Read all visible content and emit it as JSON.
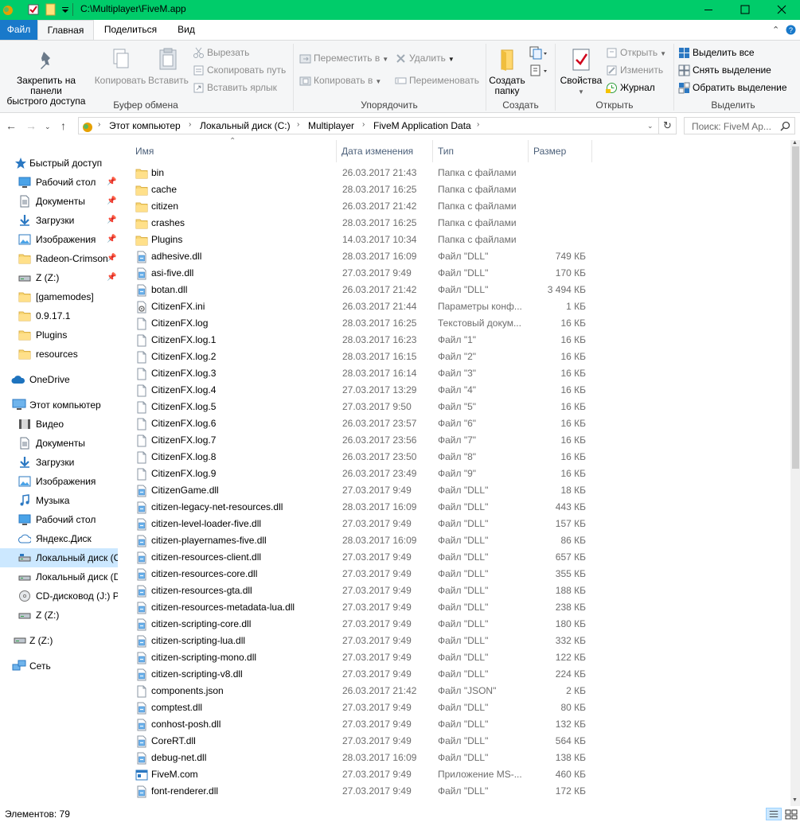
{
  "window": {
    "title": "C:\\Multiplayer\\FiveM.app"
  },
  "ribbon": {
    "tabs": [
      "Файл",
      "Главная",
      "Поделиться",
      "Вид"
    ],
    "clipboard": {
      "pin": "Закрепить на панели быстрого доступа",
      "pin_line1": "Закрепить на панели",
      "pin_line2": "быстрого доступа",
      "copy": "Копировать",
      "paste": "Вставить",
      "cut": "Вырезать",
      "copy_path": "Скопировать путь",
      "paste_shortcut": "Вставить ярлык",
      "title": "Буфер обмена"
    },
    "organize": {
      "move_to": "Переместить в",
      "copy_to": "Копировать в",
      "delete": "Удалить",
      "rename": "Переименовать",
      "title": "Упорядочить"
    },
    "create": {
      "new_folder_line1": "Создать",
      "new_folder_line2": "папку",
      "title": "Создать"
    },
    "open": {
      "properties": "Свойства",
      "open": "Открыть",
      "edit": "Изменить",
      "history": "Журнал",
      "title": "Открыть"
    },
    "select": {
      "select_all": "Выделить все",
      "select_none": "Снять выделение",
      "invert": "Обратить выделение",
      "title": "Выделить"
    }
  },
  "address": {
    "crumbs": [
      "Этот компьютер",
      "Локальный диск (C:)",
      "Multiplayer",
      "FiveM Application Data"
    ],
    "search_placeholder": "Поиск: FiveM Ap..."
  },
  "nav": {
    "quick_access": "Быстрый доступ",
    "quick_items": [
      "Рабочий стол",
      "Документы",
      "Загрузки",
      "Изображения",
      "Radeon-Crimson",
      "Z (Z:)",
      "[gamemodes]",
      "0.9.17.1",
      "Plugins",
      "resources"
    ],
    "onedrive": "OneDrive",
    "this_pc": "Этот компьютер",
    "pc_items": [
      "Видео",
      "Документы",
      "Загрузки",
      "Изображения",
      "Музыка",
      "Рабочий стол",
      "Яндекс.Диск",
      "Локальный диск (C:)",
      "Локальный диск (D:)",
      "CD-дисковод (J:) PS",
      "Z (Z:)"
    ],
    "z_drive": "Z (Z:)",
    "network": "Сеть"
  },
  "columns": {
    "name": "Имя",
    "date": "Дата изменения",
    "type": "Тип",
    "size": "Размер"
  },
  "files": [
    {
      "name": "bin",
      "date": "26.03.2017 21:43",
      "type": "Папка с файлами",
      "size": "",
      "icon": "folder"
    },
    {
      "name": "cache",
      "date": "28.03.2017 16:25",
      "type": "Папка с файлами",
      "size": "",
      "icon": "folder"
    },
    {
      "name": "citizen",
      "date": "26.03.2017 21:42",
      "type": "Папка с файлами",
      "size": "",
      "icon": "folder"
    },
    {
      "name": "crashes",
      "date": "28.03.2017 16:25",
      "type": "Папка с файлами",
      "size": "",
      "icon": "folder"
    },
    {
      "name": "Plugins",
      "date": "14.03.2017 10:34",
      "type": "Папка с файлами",
      "size": "",
      "icon": "folder"
    },
    {
      "name": "adhesive.dll",
      "date": "28.03.2017 16:09",
      "type": "Файл \"DLL\"",
      "size": "749 КБ",
      "icon": "dll"
    },
    {
      "name": "asi-five.dll",
      "date": "27.03.2017 9:49",
      "type": "Файл \"DLL\"",
      "size": "170 КБ",
      "icon": "dll"
    },
    {
      "name": "botan.dll",
      "date": "26.03.2017 21:42",
      "type": "Файл \"DLL\"",
      "size": "3 494 КБ",
      "icon": "dll"
    },
    {
      "name": "CitizenFX.ini",
      "date": "26.03.2017 21:44",
      "type": "Параметры конф...",
      "size": "1 КБ",
      "icon": "ini"
    },
    {
      "name": "CitizenFX.log",
      "date": "28.03.2017 16:25",
      "type": "Текстовый докум...",
      "size": "16 КБ",
      "icon": "file"
    },
    {
      "name": "CitizenFX.log.1",
      "date": "28.03.2017 16:23",
      "type": "Файл \"1\"",
      "size": "16 КБ",
      "icon": "file"
    },
    {
      "name": "CitizenFX.log.2",
      "date": "28.03.2017 16:15",
      "type": "Файл \"2\"",
      "size": "16 КБ",
      "icon": "file"
    },
    {
      "name": "CitizenFX.log.3",
      "date": "28.03.2017 16:14",
      "type": "Файл \"3\"",
      "size": "16 КБ",
      "icon": "file"
    },
    {
      "name": "CitizenFX.log.4",
      "date": "27.03.2017 13:29",
      "type": "Файл \"4\"",
      "size": "16 КБ",
      "icon": "file"
    },
    {
      "name": "CitizenFX.log.5",
      "date": "27.03.2017 9:50",
      "type": "Файл \"5\"",
      "size": "16 КБ",
      "icon": "file"
    },
    {
      "name": "CitizenFX.log.6",
      "date": "26.03.2017 23:57",
      "type": "Файл \"6\"",
      "size": "16 КБ",
      "icon": "file"
    },
    {
      "name": "CitizenFX.log.7",
      "date": "26.03.2017 23:56",
      "type": "Файл \"7\"",
      "size": "16 КБ",
      "icon": "file"
    },
    {
      "name": "CitizenFX.log.8",
      "date": "26.03.2017 23:50",
      "type": "Файл \"8\"",
      "size": "16 КБ",
      "icon": "file"
    },
    {
      "name": "CitizenFX.log.9",
      "date": "26.03.2017 23:49",
      "type": "Файл \"9\"",
      "size": "16 КБ",
      "icon": "file"
    },
    {
      "name": "CitizenGame.dll",
      "date": "27.03.2017 9:49",
      "type": "Файл \"DLL\"",
      "size": "18 КБ",
      "icon": "dll"
    },
    {
      "name": "citizen-legacy-net-resources.dll",
      "date": "28.03.2017 16:09",
      "type": "Файл \"DLL\"",
      "size": "443 КБ",
      "icon": "dll"
    },
    {
      "name": "citizen-level-loader-five.dll",
      "date": "27.03.2017 9:49",
      "type": "Файл \"DLL\"",
      "size": "157 КБ",
      "icon": "dll"
    },
    {
      "name": "citizen-playernames-five.dll",
      "date": "28.03.2017 16:09",
      "type": "Файл \"DLL\"",
      "size": "86 КБ",
      "icon": "dll"
    },
    {
      "name": "citizen-resources-client.dll",
      "date": "27.03.2017 9:49",
      "type": "Файл \"DLL\"",
      "size": "657 КБ",
      "icon": "dll"
    },
    {
      "name": "citizen-resources-core.dll",
      "date": "27.03.2017 9:49",
      "type": "Файл \"DLL\"",
      "size": "355 КБ",
      "icon": "dll"
    },
    {
      "name": "citizen-resources-gta.dll",
      "date": "27.03.2017 9:49",
      "type": "Файл \"DLL\"",
      "size": "188 КБ",
      "icon": "dll"
    },
    {
      "name": "citizen-resources-metadata-lua.dll",
      "date": "27.03.2017 9:49",
      "type": "Файл \"DLL\"",
      "size": "238 КБ",
      "icon": "dll"
    },
    {
      "name": "citizen-scripting-core.dll",
      "date": "27.03.2017 9:49",
      "type": "Файл \"DLL\"",
      "size": "180 КБ",
      "icon": "dll"
    },
    {
      "name": "citizen-scripting-lua.dll",
      "date": "27.03.2017 9:49",
      "type": "Файл \"DLL\"",
      "size": "332 КБ",
      "icon": "dll"
    },
    {
      "name": "citizen-scripting-mono.dll",
      "date": "27.03.2017 9:49",
      "type": "Файл \"DLL\"",
      "size": "122 КБ",
      "icon": "dll"
    },
    {
      "name": "citizen-scripting-v8.dll",
      "date": "27.03.2017 9:49",
      "type": "Файл \"DLL\"",
      "size": "224 КБ",
      "icon": "dll"
    },
    {
      "name": "components.json",
      "date": "26.03.2017 21:42",
      "type": "Файл \"JSON\"",
      "size": "2 КБ",
      "icon": "file"
    },
    {
      "name": "comptest.dll",
      "date": "27.03.2017 9:49",
      "type": "Файл \"DLL\"",
      "size": "80 КБ",
      "icon": "dll"
    },
    {
      "name": "conhost-posh.dll",
      "date": "27.03.2017 9:49",
      "type": "Файл \"DLL\"",
      "size": "132 КБ",
      "icon": "dll"
    },
    {
      "name": "CoreRT.dll",
      "date": "27.03.2017 9:49",
      "type": "Файл \"DLL\"",
      "size": "564 КБ",
      "icon": "dll"
    },
    {
      "name": "debug-net.dll",
      "date": "28.03.2017 16:09",
      "type": "Файл \"DLL\"",
      "size": "138 КБ",
      "icon": "dll"
    },
    {
      "name": "FiveM.com",
      "date": "27.03.2017 9:49",
      "type": "Приложение MS-...",
      "size": "460 КБ",
      "icon": "exe"
    },
    {
      "name": "font-renderer.dll",
      "date": "27.03.2017 9:49",
      "type": "Файл \"DLL\"",
      "size": "172 КБ",
      "icon": "dll"
    }
  ],
  "status": {
    "items_count": "Элементов: 79"
  }
}
